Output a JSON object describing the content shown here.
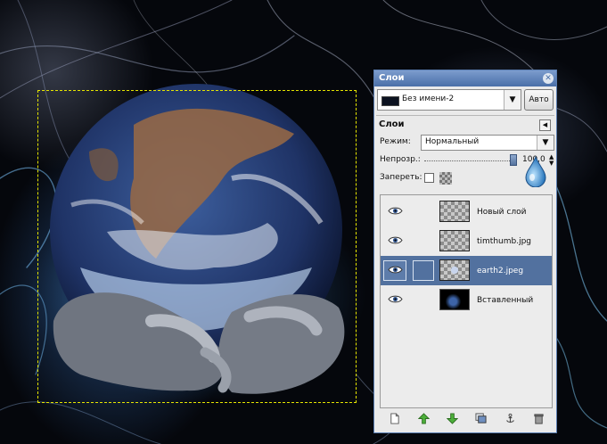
{
  "dock": {
    "title": "Слои",
    "close_icon": "close-icon",
    "image_menu": {
      "value": "Без имени-2"
    },
    "auto_label": "Авто",
    "panel_title": "Слои",
    "mode_label": "Режим:",
    "mode_value": "Нормальный",
    "opacity_label": "Непрозр.:",
    "opacity_value": "100,0",
    "opacity_percent": 100,
    "lock_label": "Запереть:"
  },
  "layers": [
    {
      "name": "Новый слой",
      "visible": true,
      "selected": false,
      "thumb": "transparent"
    },
    {
      "name": "timthumb.jpg",
      "visible": true,
      "selected": false,
      "thumb": "transparent"
    },
    {
      "name": "earth2.jpeg",
      "visible": true,
      "selected": true,
      "thumb": "earth"
    },
    {
      "name": "Вставленный",
      "visible": true,
      "selected": false,
      "thumb": "dark"
    }
  ],
  "bottom_buttons": [
    {
      "name": "new-layer-button",
      "icon": "new-page-icon"
    },
    {
      "name": "raise-layer-button",
      "icon": "arrow-up-icon"
    },
    {
      "name": "lower-layer-button",
      "icon": "arrow-down-icon"
    },
    {
      "name": "duplicate-layer-button",
      "icon": "duplicate-icon"
    },
    {
      "name": "anchor-layer-button",
      "icon": "anchor-icon"
    },
    {
      "name": "delete-layer-button",
      "icon": "trash-icon"
    }
  ],
  "colors": {
    "title_bar": "#4a6fa8",
    "selected_row": "#52719f",
    "selection_outline": "#e6e600"
  }
}
